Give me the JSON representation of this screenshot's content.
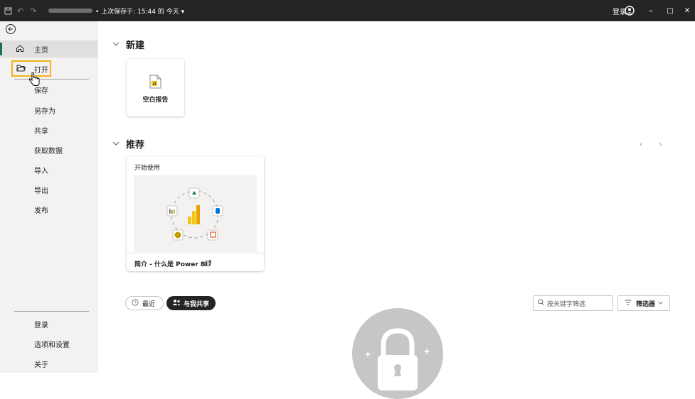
{
  "titlebar": {
    "last_saved": "• 上次保存于: 15:44 的 今天 ▾",
    "signin": "登录",
    "minimize": "–",
    "maximize": "□",
    "close": "✕"
  },
  "sidebar": {
    "items": [
      {
        "label": "主页",
        "icon": "home-icon"
      },
      {
        "label": "打开",
        "icon": "folder-open-icon"
      },
      {
        "label": "保存"
      },
      {
        "label": "另存为"
      },
      {
        "label": "共享"
      },
      {
        "label": "获取数据"
      },
      {
        "label": "导入"
      },
      {
        "label": "导出"
      },
      {
        "label": "发布"
      }
    ],
    "bottom_items": [
      {
        "label": "登录"
      },
      {
        "label": "选项和设置"
      },
      {
        "label": "关于"
      }
    ]
  },
  "main": {
    "new_section": {
      "title": "新建",
      "blank_report": "空白报告"
    },
    "recommended": {
      "title": "推荐",
      "card_title": "开始使用",
      "card_footer": "简介 - 什么是 Power BI?"
    },
    "tabs": {
      "recent": "最近",
      "shared": "与我共享"
    },
    "search_placeholder": "按关键字筛选",
    "filter_label": "筛选器"
  },
  "colors": {
    "titlebar": "#252423",
    "accent": "#f2b319",
    "nav_selected_bar": "#1e6e5a"
  }
}
